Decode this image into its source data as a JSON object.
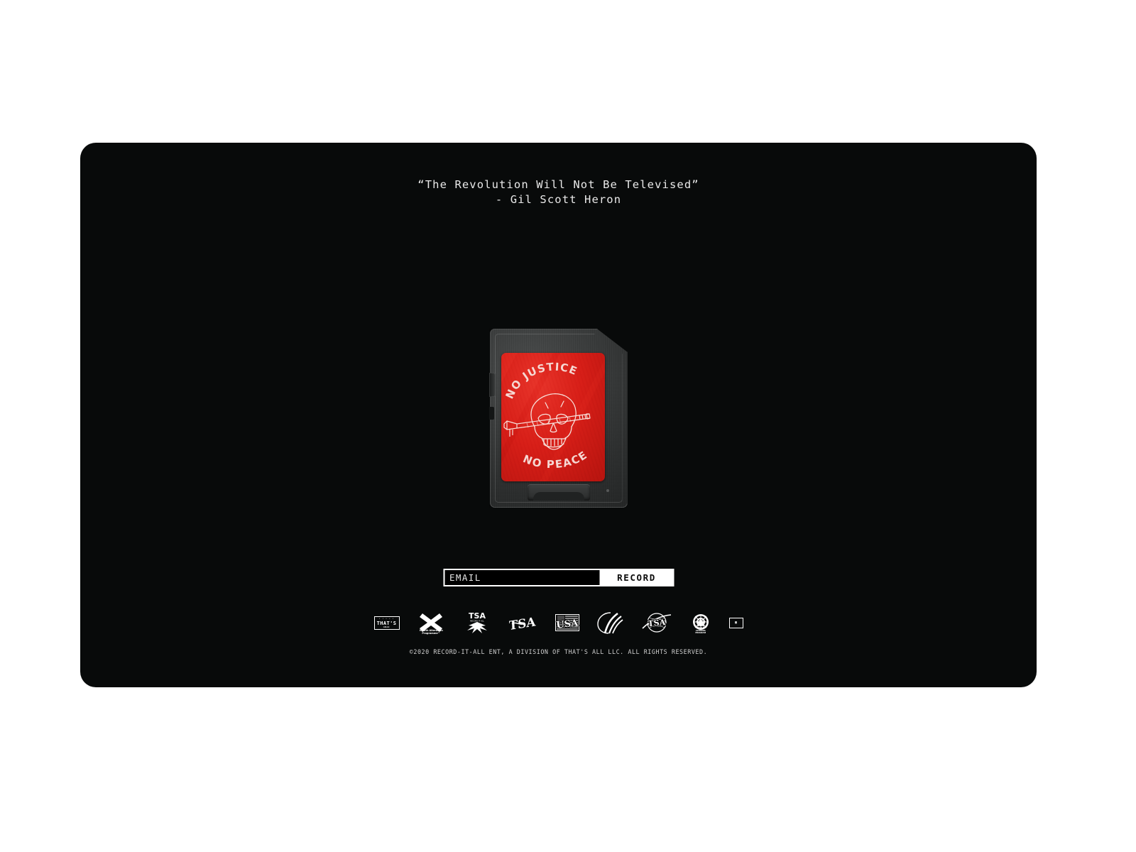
{
  "page": {
    "background_color": "#ffffff",
    "panel_color": "#080a0a"
  },
  "quote": {
    "line1": "“The Revolution Will Not Be Televised”",
    "line2": "- Gil Scott Heron"
  },
  "card": {
    "label_color": "#d81f18",
    "body_color": "#343636",
    "art": {
      "top_text": "NO JUSTICE",
      "bottom_text": "NO PEACE",
      "figure": "skull-with-pencil-through-eyes"
    }
  },
  "form": {
    "email_placeholder": "EMAIL",
    "email_value": "",
    "submit_label": "RECORD"
  },
  "logos": [
    {
      "id": "thats-all-badge",
      "top": "• • • • •",
      "main": "THAT'S",
      "sub": "ALL",
      "sub2": "2020"
    },
    {
      "id": "health-alteration",
      "caption": "Health Alteration\nProgramme™"
    },
    {
      "id": "tsa-bull",
      "caption": "TSA"
    },
    {
      "id": "tsa-warped",
      "caption": "TSA"
    },
    {
      "id": "usa-flag-box",
      "caption": "USA"
    },
    {
      "id": "swoosh-mark",
      "caption": ""
    },
    {
      "id": "nasa-globe-tsa",
      "caption": "TSA"
    },
    {
      "id": "world-seal",
      "caption": "WORLD\nALTERING\nPROGRAM"
    },
    {
      "id": "micro-box",
      "caption": "▦"
    }
  ],
  "footer": {
    "copyright": "©2020 RECORD-IT-ALL ENT, A DIVISION OF THAT'S ALL LLC. ALL RIGHTS RESERVED."
  }
}
